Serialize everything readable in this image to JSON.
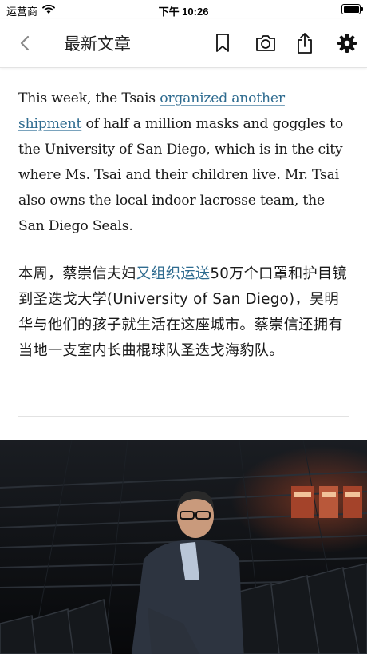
{
  "status": {
    "carrier": "运营商",
    "time": "下午 10:26"
  },
  "nav": {
    "title": "最新文章",
    "icons": [
      "back-icon",
      "bookmark-icon",
      "camera-icon",
      "share-icon",
      "gear-icon"
    ]
  },
  "article": {
    "en": {
      "before": "This week, the Tsais ",
      "link": "organized another shipment",
      "after": " of half a million masks and goggles to the University of San Diego, which is in the city where Ms. Tsai and their children live. Mr. Tsai also owns the local indoor lacrosse team, the San Diego Seals."
    },
    "zh": {
      "before": "本周，蔡崇信夫妇",
      "link": "又组织运送",
      "after": "50万个口罩和护目镜到圣迭戈大学(University of San Diego)，吴明华与他们的孩子就生活在这座城市。蔡崇信还拥有当地一支室内长曲棍球队圣迭戈海豹队。"
    }
  },
  "colors": {
    "link": "#2e6b8f",
    "text": "#1a1a1a",
    "photo_bg": "#0d0f12"
  }
}
